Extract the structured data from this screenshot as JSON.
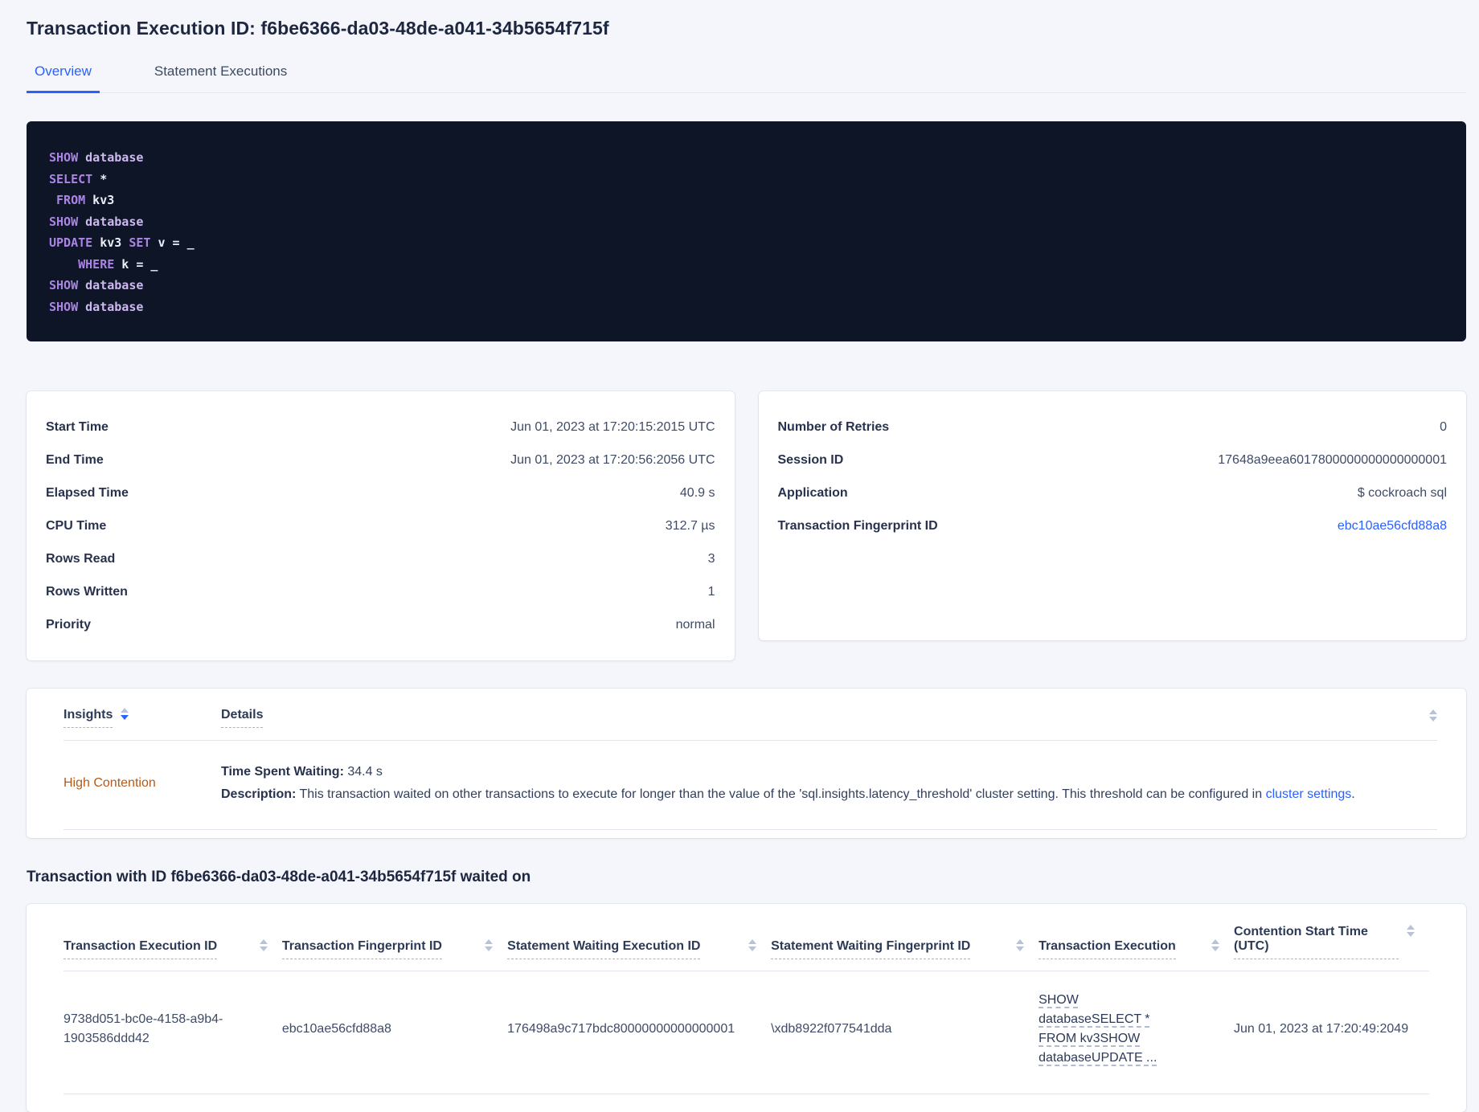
{
  "colors": {
    "accent_blue": "#2861ff",
    "insight_warning_orange": "#b55a19",
    "code_background": "#0d1527",
    "code_keyword": "#ab84e4",
    "code_identifier": "#cdb9f0",
    "code_plain": "#eceef7"
  },
  "page": {
    "title": "Transaction Execution ID: f6be6366-da03-48de-a041-34b5654f715f"
  },
  "tabs": [
    {
      "label": "Overview"
    },
    {
      "label": "Statement Executions"
    }
  ],
  "sql": {
    "lines": [
      [
        {
          "c": "kw",
          "t": "SHOW"
        },
        {
          "c": "id",
          "t": " database"
        }
      ],
      [
        {
          "c": "kw",
          "t": "SELECT"
        },
        {
          "c": "pl",
          "t": " *"
        }
      ],
      [
        {
          "c": "pl",
          "t": " "
        },
        {
          "c": "kw",
          "t": "FROM"
        },
        {
          "c": "pl",
          "t": " kv3"
        }
      ],
      [
        {
          "c": "kw",
          "t": "SHOW"
        },
        {
          "c": "id",
          "t": " database"
        }
      ],
      [
        {
          "c": "kw",
          "t": "UPDATE"
        },
        {
          "c": "pl",
          "t": " kv3 "
        },
        {
          "c": "kw",
          "t": "SET"
        },
        {
          "c": "pl",
          "t": " v = _"
        }
      ],
      [
        {
          "c": "pl",
          "t": "    "
        },
        {
          "c": "kw",
          "t": "WHERE"
        },
        {
          "c": "pl",
          "t": " k = _"
        }
      ],
      [
        {
          "c": "kw",
          "t": "SHOW"
        },
        {
          "c": "id",
          "t": " database"
        }
      ],
      [
        {
          "c": "kw",
          "t": "SHOW"
        },
        {
          "c": "id",
          "t": " database"
        }
      ]
    ]
  },
  "summary_left": {
    "rows": [
      {
        "label": "Start Time",
        "value": "Jun 01, 2023 at 17:20:15:2015 UTC"
      },
      {
        "label": "End Time",
        "value": "Jun 01, 2023 at 17:20:56:2056 UTC"
      },
      {
        "label": "Elapsed Time",
        "value": "40.9 s"
      },
      {
        "label": "CPU Time",
        "value": "312.7 µs"
      },
      {
        "label": "Rows Read",
        "value": "3"
      },
      {
        "label": "Rows Written",
        "value": "1"
      },
      {
        "label": "Priority",
        "value": "normal"
      }
    ]
  },
  "summary_right": {
    "rows": [
      {
        "label": "Number of Retries",
        "value": "0"
      },
      {
        "label": "Session ID",
        "value": "17648a9eea6017800000000000000001"
      },
      {
        "label": "Application",
        "value": "$ cockroach sql"
      },
      {
        "label": "Transaction Fingerprint ID",
        "value": "ebc10ae56cfd88a8"
      }
    ]
  },
  "insights": {
    "columns": [
      {
        "label": "Insights"
      },
      {
        "label": "Details"
      }
    ],
    "row": {
      "insight": "High Contention",
      "waiting_label": "Time Spent Waiting:",
      "waiting_value": " 34.4 s",
      "description_label": "Description:",
      "description_text": " This transaction waited on other transactions to execute for longer than the value of the 'sql.insights.latency_threshold' cluster setting. This threshold can be configured in ",
      "description_link": "cluster settings",
      "description_suffix": "."
    }
  },
  "waited_on": {
    "heading": "Transaction with ID f6be6366-da03-48de-a041-34b5654f715f waited on",
    "columns": [
      "Transaction Execution ID",
      "Transaction Fingerprint ID",
      "Statement Waiting Execution ID",
      "Statement Waiting Fingerprint ID",
      "Transaction Execution",
      "Contention Start Time (UTC)"
    ],
    "row": {
      "transaction_execution_id": "9738d051-bc0e-4158-a9b4-1903586ddd42",
      "transaction_fingerprint_id": "ebc10ae56cfd88a8",
      "statement_waiting_execution_id": "176498a9c717bdc80000000000000001",
      "statement_waiting_fingerprint_id": "\\xdb8922f077541dda",
      "transaction_execution": "SHOW databaseSELECT * FROM kv3SHOW databaseUPDATE ...",
      "contention_start_time": "Jun 01, 2023 at 17:20:49:2049"
    }
  }
}
